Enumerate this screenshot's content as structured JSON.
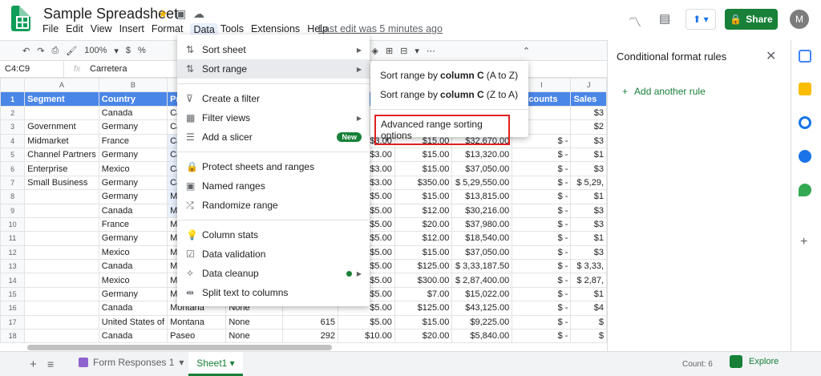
{
  "app": {
    "title": "Sample Spreadsheet",
    "menus": [
      "File",
      "Edit",
      "View",
      "Insert",
      "Format",
      "Data",
      "Tools",
      "Extensions",
      "Help"
    ],
    "last_edit": "Last edit was 5 minutes ago",
    "share_label": "Share",
    "avatar_letter": "M"
  },
  "toolbar": {
    "zoom": "100%",
    "currency": "$",
    "percent": "%",
    "decimals": ".0"
  },
  "formula": {
    "namebox": "C4:C9",
    "value": "Carretera"
  },
  "grid": {
    "columns": [
      "A",
      "B",
      "C",
      "D",
      "E",
      "F",
      "G",
      "H",
      "I",
      "J"
    ],
    "rows": [
      [
        "1",
        "Segment",
        "Country",
        "Product",
        "",
        "",
        "",
        "",
        "",
        "Discounts",
        "Sales"
      ],
      [
        "2",
        "",
        "Canada",
        "Carretera",
        "",
        "",
        "",
        "",
        "",
        "",
        "$3"
      ],
      [
        "3",
        "Government",
        "Germany",
        "Carretera",
        "",
        "",
        "",
        "",
        "",
        "",
        "$2"
      ],
      [
        "4",
        "Midmarket",
        "France",
        "Carretera",
        "",
        "",
        "$3.00",
        "$15.00",
        "$32,670.00",
        "$ -",
        "$3"
      ],
      [
        "5",
        "Channel Partners",
        "Germany",
        "Carretera",
        "",
        "",
        "$3.00",
        "$15.00",
        "$13,320.00",
        "$ -",
        "$1"
      ],
      [
        "6",
        "Enterprise",
        "Mexico",
        "Carretera",
        "",
        "",
        "$3.00",
        "$15.00",
        "$37,050.00",
        "$ -",
        "$3"
      ],
      [
        "7",
        "Small Business",
        "Germany",
        "Carretera",
        "",
        "",
        "$3.00",
        "$350.00",
        "$ 5,29,550.00",
        "$ -",
        "$ 5,29,"
      ],
      [
        "8",
        "",
        "Germany",
        "Montana",
        "",
        "",
        "$5.00",
        "$15.00",
        "$13,815.00",
        "$ -",
        "$1"
      ],
      [
        "9",
        "",
        "Canada",
        "Montana",
        "",
        "",
        "$5.00",
        "$12.00",
        "$30,216.00",
        "$ -",
        "$3"
      ],
      [
        "10",
        "",
        "France",
        "Montana",
        "",
        "",
        "$5.00",
        "$20.00",
        "$37,980.00",
        "$ -",
        "$3"
      ],
      [
        "11",
        "",
        "Germany",
        "Montana",
        "",
        "",
        "$5.00",
        "$12.00",
        "$18,540.00",
        "$ -",
        "$1"
      ],
      [
        "12",
        "",
        "Mexico",
        "Montana",
        "",
        "",
        "$5.00",
        "$15.00",
        "$37,050.00",
        "$ -",
        "$3"
      ],
      [
        "13",
        "",
        "Canada",
        "Montana",
        "",
        "",
        "$5.00",
        "$125.00",
        "$ 3,33,187.50",
        "$ -",
        "$ 3,33,"
      ],
      [
        "14",
        "",
        "Mexico",
        "Montana",
        "",
        "",
        "$5.00",
        "$300.00",
        "$ 2,87,400.00",
        "$ -",
        "$ 2,87,"
      ],
      [
        "15",
        "",
        "Germany",
        "Montana",
        "",
        "",
        "$5.00",
        "$7.00",
        "$15,022.00",
        "$ -",
        "$1"
      ],
      [
        "16",
        "",
        "Canada",
        "Montana",
        "None",
        "",
        "$5.00",
        "$125.00",
        "$43,125.00",
        "$ -",
        "$4"
      ],
      [
        "17",
        "",
        "United States of",
        "Montana",
        "None",
        "615",
        "$5.00",
        "$15.00",
        "$9,225.00",
        "$ -",
        "$"
      ],
      [
        "18",
        "",
        "Canada",
        "Paseo",
        "None",
        "292",
        "$10.00",
        "$20.00",
        "$5,840.00",
        "$ -",
        "$"
      ]
    ]
  },
  "data_menu": {
    "items": [
      {
        "label": "Sort sheet",
        "icon": "sort-icon",
        "arrow": "▶"
      },
      {
        "label": "Sort range",
        "icon": "sort-icon",
        "arrow": "▶"
      },
      {
        "label": "Create a filter",
        "icon": "filter-icon"
      },
      {
        "label": "Filter views",
        "icon": "filter-views-icon",
        "arrow": "▶"
      },
      {
        "label": "Add a slicer",
        "icon": "slicer-icon",
        "badge": "New"
      },
      {
        "label": "Protect sheets and ranges",
        "icon": "lock-icon"
      },
      {
        "label": "Named ranges",
        "icon": "named-ranges-icon"
      },
      {
        "label": "Randomize range",
        "icon": "shuffle-icon"
      },
      {
        "label": "Column stats",
        "icon": "lightbulb-icon"
      },
      {
        "label": "Data validation",
        "icon": "validation-icon"
      },
      {
        "label": "Data cleanup",
        "icon": "cleanup-icon",
        "arrow": "▶"
      },
      {
        "label": "Split text to columns",
        "icon": "split-icon"
      }
    ]
  },
  "sort_submenu": {
    "az_prefix": "Sort range by ",
    "az_col": "column C",
    "az_suffix": " (A to Z)",
    "za_prefix": "Sort range by ",
    "za_col": "column C",
    "za_suffix": " (Z to A)",
    "advanced": "Advanced range sorting options"
  },
  "panel": {
    "title": "Conditional format rules",
    "add_rule": "Add another rule"
  },
  "bottom": {
    "form_tab": "Form Responses 1",
    "active_tab": "Sheet1",
    "count": "Count: 6",
    "explore": "Explore"
  }
}
